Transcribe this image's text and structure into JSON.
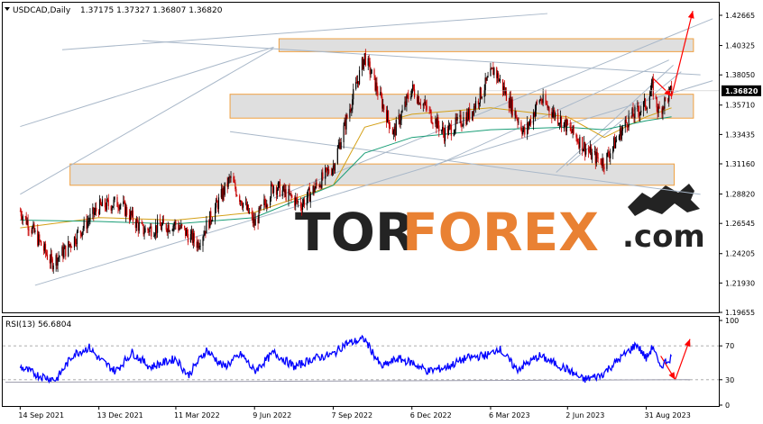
{
  "header": {
    "symbol_label": "USDCAD,Daily",
    "ohlc": "1.37175 1.37327 1.36807 1.36820"
  },
  "rsi_panel": {
    "label": "RSI(13) 56.6804"
  },
  "watermark": {
    "brand_left": "TOR",
    "brand_right": "FOREX",
    "suffix": ".com"
  },
  "colors": {
    "candle_bull": "#000000",
    "candle_bear": "#c80000",
    "ma_fast": "#d4a017",
    "ma_slow": "#1a9e77",
    "rsi_line": "#0000ff",
    "zone_fill": "#d9d9d9",
    "zone_border": "#f0a040",
    "trend_line": "#a9b8c9",
    "arrow": "#ff0000",
    "price_tag_bg": "#000000",
    "brand_right": "#e87722",
    "brand_left": "#111111"
  },
  "chart_data": [
    {
      "type": "candlestick",
      "title": "USDCAD,Daily",
      "y_ticks": [
        "1.42665",
        "1.40325",
        "1.38050",
        "1.35710",
        "1.33435",
        "1.31160",
        "1.28820",
        "1.26545",
        "1.24205",
        "1.21930",
        "1.19655"
      ],
      "x_ticks": [
        "14 Sep 2021",
        "13 Dec 2021",
        "11 Mar 2022",
        "9 Jun 2022",
        "7 Sep 2022",
        "6 Dec 2022",
        "6 Mar 2023",
        "2 Jun 2023",
        "31 Aug 2023"
      ],
      "ylim": [
        1.195,
        1.43
      ],
      "current_price": "1.36820",
      "price_path": [
        {
          "x": "14 Sep 2021",
          "y": 1.275
        },
        {
          "x": "24 Sep 2021",
          "y": 1.265
        },
        {
          "x": "20 Oct 2021",
          "y": 1.235
        },
        {
          "x": "5 Nov 2021",
          "y": 1.245
        },
        {
          "x": "13 Dec 2021",
          "y": 1.278
        },
        {
          "x": "5 Jan 2022",
          "y": 1.282
        },
        {
          "x": "1 Feb 2022",
          "y": 1.26
        },
        {
          "x": "11 Mar 2022",
          "y": 1.265
        },
        {
          "x": "5 Apr 2022",
          "y": 1.25
        },
        {
          "x": "12 May 2022",
          "y": 1.3
        },
        {
          "x": "9 Jun 2022",
          "y": 1.265
        },
        {
          "x": "1 Jul 2022",
          "y": 1.295
        },
        {
          "x": "1 Aug 2022",
          "y": 1.28
        },
        {
          "x": "7 Sep 2022",
          "y": 1.31
        },
        {
          "x": "13 Oct 2022",
          "y": 1.395
        },
        {
          "x": "15 Nov 2022",
          "y": 1.335
        },
        {
          "x": "6 Dec 2022",
          "y": 1.37
        },
        {
          "x": "12 Jan 2023",
          "y": 1.335
        },
        {
          "x": "10 Feb 2023",
          "y": 1.35
        },
        {
          "x": "10 Mar 2023",
          "y": 1.385
        },
        {
          "x": "14 Apr 2023",
          "y": 1.335
        },
        {
          "x": "1 May 2023",
          "y": 1.362
        },
        {
          "x": "2 Jun 2023",
          "y": 1.34
        },
        {
          "x": "30 Jun 2023",
          "y": 1.318
        },
        {
          "x": "14 Jul 2023",
          "y": 1.313
        },
        {
          "x": "9 Aug 2023",
          "y": 1.345
        },
        {
          "x": "31 Aug 2023",
          "y": 1.358
        },
        {
          "x": "7 Sep 2023",
          "y": 1.371
        },
        {
          "x": "14 Sep 2023",
          "y": 1.352
        },
        {
          "x": "29 Sep 2023",
          "y": 1.368
        }
      ],
      "ma_fast": [
        {
          "x": "14 Sep 2021",
          "y": 1.262
        },
        {
          "x": "13 Dec 2021",
          "y": 1.27
        },
        {
          "x": "11 Mar 2022",
          "y": 1.268
        },
        {
          "x": "9 Jun 2022",
          "y": 1.274
        },
        {
          "x": "7 Sep 2022",
          "y": 1.295
        },
        {
          "x": "13 Oct 2022",
          "y": 1.34
        },
        {
          "x": "6 Dec 2022",
          "y": 1.35
        },
        {
          "x": "6 Mar 2023",
          "y": 1.355
        },
        {
          "x": "2 Jun 2023",
          "y": 1.348
        },
        {
          "x": "14 Jul 2023",
          "y": 1.332
        },
        {
          "x": "31 Aug 2023",
          "y": 1.348
        },
        {
          "x": "29 Sep 2023",
          "y": 1.355
        }
      ],
      "ma_slow": [
        {
          "x": "14 Sep 2021",
          "y": 1.268
        },
        {
          "x": "13 Dec 2021",
          "y": 1.267
        },
        {
          "x": "11 Mar 2022",
          "y": 1.265
        },
        {
          "x": "9 Jun 2022",
          "y": 1.27
        },
        {
          "x": "7 Sep 2022",
          "y": 1.295
        },
        {
          "x": "13 Oct 2022",
          "y": 1.32
        },
        {
          "x": "6 Dec 2022",
          "y": 1.332
        },
        {
          "x": "6 Mar 2023",
          "y": 1.338
        },
        {
          "x": "2 Jun 2023",
          "y": 1.34
        },
        {
          "x": "14 Jul 2023",
          "y": 1.338
        },
        {
          "x": "31 Aug 2023",
          "y": 1.345
        },
        {
          "x": "29 Sep 2023",
          "y": 1.348
        }
      ],
      "zones": [
        {
          "x_from": "7 Jul 2022",
          "x_to": "24 Oct 2023",
          "y_low": 1.3985,
          "y_high": 1.4085
        },
        {
          "x_from": "12 May 2022",
          "x_to": "24 Oct 2023",
          "y_low": 1.347,
          "y_high": 1.3655
        },
        {
          "x_from": "10 Nov 2021",
          "x_to": "2 Oct 2023",
          "y_low": 1.295,
          "y_high": 1.3115
        }
      ]
    },
    {
      "type": "line",
      "title": "RSI(13) 56.6804",
      "y_ticks": [
        "100",
        "70",
        "30",
        "0"
      ],
      "ylim": [
        0,
        100
      ],
      "levels": [
        70,
        30
      ],
      "series": [
        {
          "values": [
            {
              "x": "14 Sep 2021",
              "y": 45
            },
            {
              "x": "5 Oct 2021",
              "y": 35
            },
            {
              "x": "25 Oct 2021",
              "y": 30
            },
            {
              "x": "14 Nov 2021",
              "y": 60
            },
            {
              "x": "2 Dec 2021",
              "y": 68
            },
            {
              "x": "13 Dec 2021",
              "y": 55
            },
            {
              "x": "1 Jan 2022",
              "y": 40
            },
            {
              "x": "20 Jan 2022",
              "y": 62
            },
            {
              "x": "10 Feb 2022",
              "y": 45
            },
            {
              "x": "11 Mar 2022",
              "y": 55
            },
            {
              "x": "25 Mar 2022",
              "y": 35
            },
            {
              "x": "15 Apr 2022",
              "y": 65
            },
            {
              "x": "5 May 2022",
              "y": 45
            },
            {
              "x": "25 May 2022",
              "y": 60
            },
            {
              "x": "9 Jun 2022",
              "y": 40
            },
            {
              "x": "1 Jul 2022",
              "y": 62
            },
            {
              "x": "25 Jul 2022",
              "y": 45
            },
            {
              "x": "15 Aug 2022",
              "y": 55
            },
            {
              "x": "7 Sep 2022",
              "y": 60
            },
            {
              "x": "20 Sep 2022",
              "y": 72
            },
            {
              "x": "13 Oct 2022",
              "y": 78
            },
            {
              "x": "1 Nov 2022",
              "y": 45
            },
            {
              "x": "20 Nov 2022",
              "y": 55
            },
            {
              "x": "6 Dec 2022",
              "y": 50
            },
            {
              "x": "25 Dec 2022",
              "y": 40
            },
            {
              "x": "15 Jan 2023",
              "y": 45
            },
            {
              "x": "5 Feb 2023",
              "y": 55
            },
            {
              "x": "6 Mar 2023",
              "y": 60
            },
            {
              "x": "15 Mar 2023",
              "y": 68
            },
            {
              "x": "5 Apr 2023",
              "y": 42
            },
            {
              "x": "1 May 2023",
              "y": 58
            },
            {
              "x": "2 Jun 2023",
              "y": 42
            },
            {
              "x": "20 Jun 2023",
              "y": 30
            },
            {
              "x": "10 Jul 2023",
              "y": 35
            },
            {
              "x": "1 Aug 2023",
              "y": 55
            },
            {
              "x": "20 Aug 2023",
              "y": 72
            },
            {
              "x": "31 Aug 2023",
              "y": 55
            },
            {
              "x": "8 Sep 2023",
              "y": 70
            },
            {
              "x": "15 Sep 2023",
              "y": 45
            },
            {
              "x": "29 Sep 2023",
              "y": 56.68
            }
          ]
        }
      ]
    }
  ]
}
